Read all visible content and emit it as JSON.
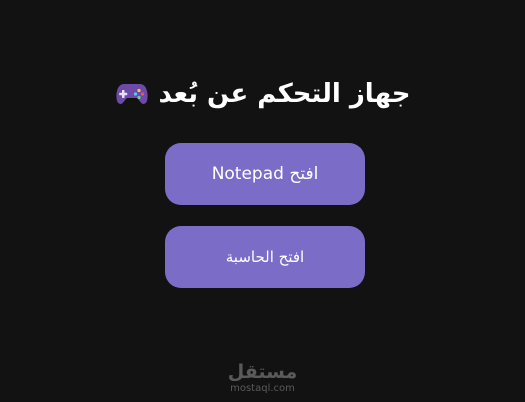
{
  "header": {
    "title": "جهاز التحكم عن بُعد",
    "icon": "gamepad-icon"
  },
  "buttons": {
    "open_notepad": "افتح Notepad",
    "open_calculator": "افتح الحاسبة"
  },
  "watermark": {
    "logo": "مستقل",
    "url": "mostaql.com"
  },
  "colors": {
    "background": "#121212",
    "button": "#7b6cc8",
    "text": "#ffffff",
    "gamepad": "#6d4aa8"
  }
}
